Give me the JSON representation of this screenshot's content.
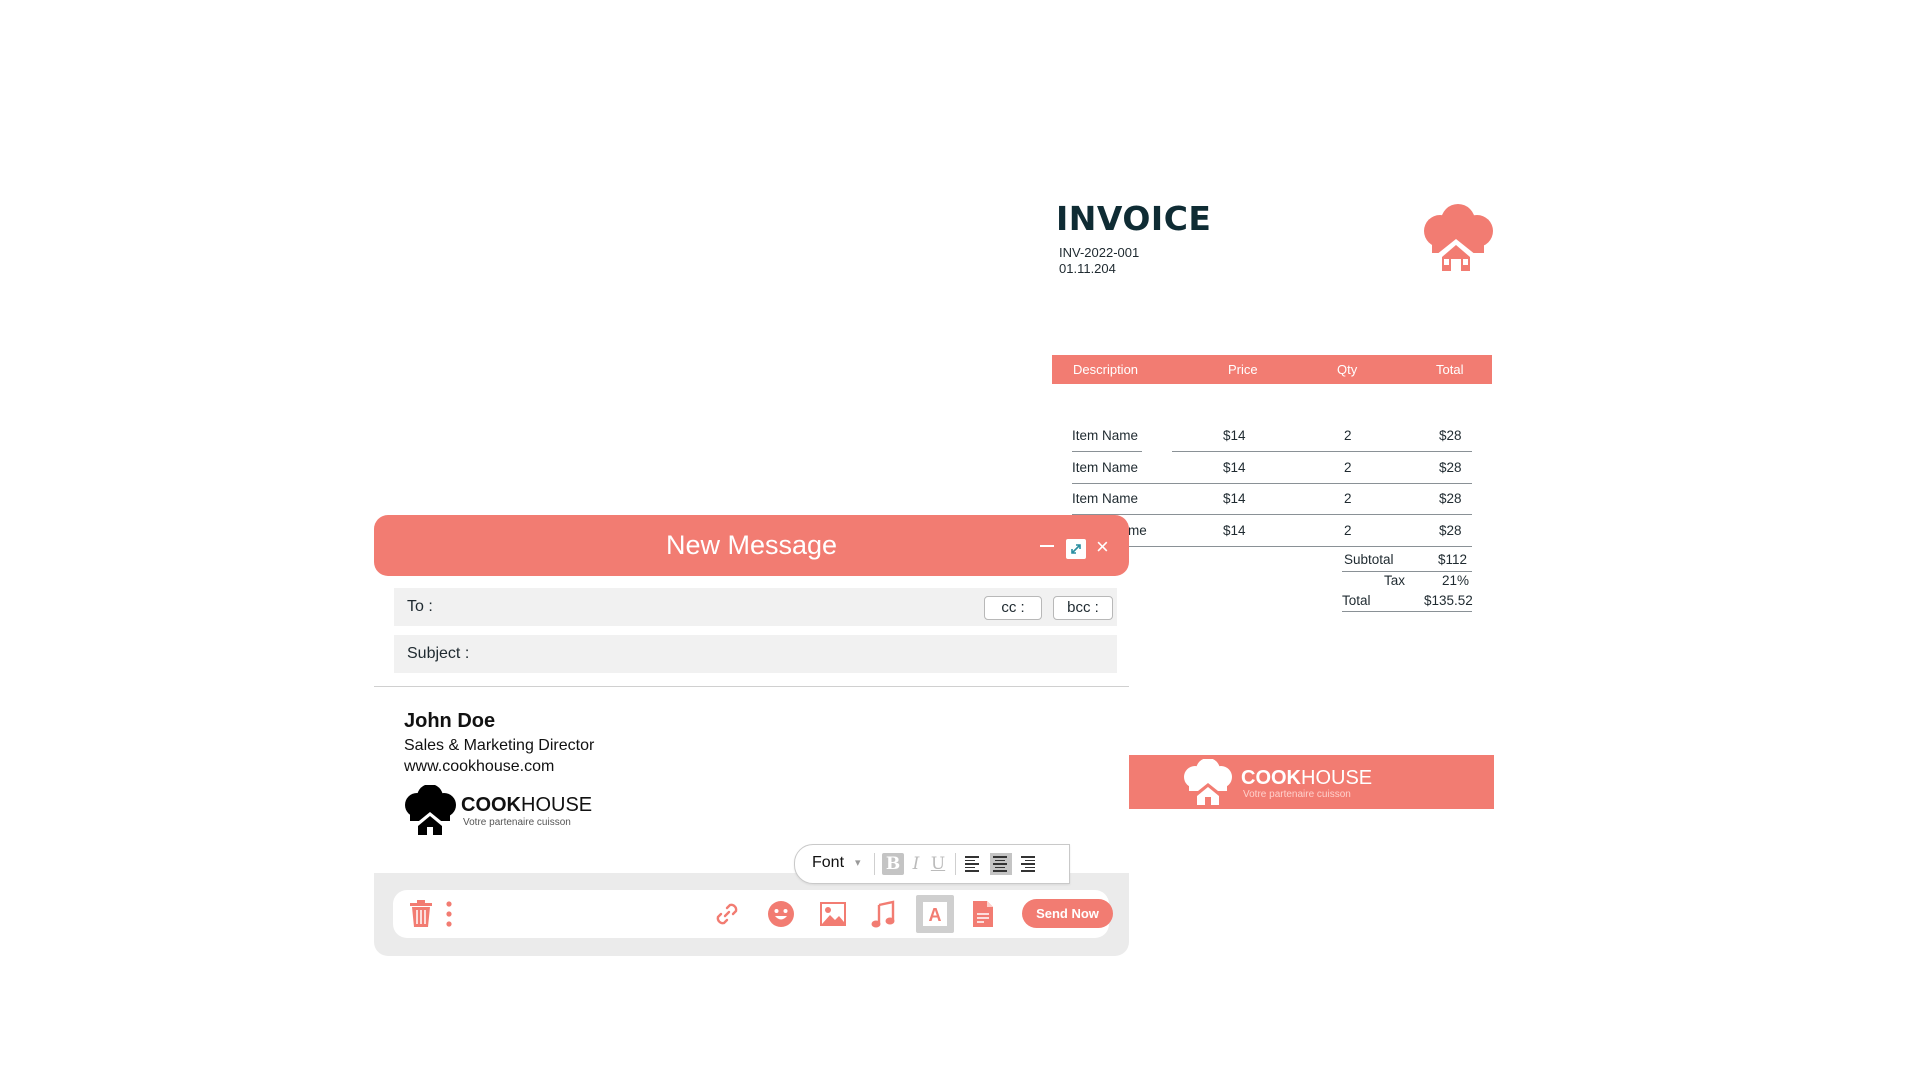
{
  "invoice": {
    "title": "INVOICE",
    "number": "INV-2022-001",
    "date": "01.11.204",
    "columns": [
      "Description",
      "Price",
      "Qty",
      "Total"
    ],
    "rows": [
      {
        "description": "Item Name",
        "price": "$14",
        "qty": "2",
        "total": "$28"
      },
      {
        "description": "Item Name",
        "price": "$14",
        "qty": "2",
        "total": "$28"
      },
      {
        "description": "Item Name",
        "price": "$14",
        "qty": "2",
        "total": "$28"
      },
      {
        "description": "me",
        "price": "$14",
        "qty": "2",
        "total": "$28"
      }
    ],
    "subtotal_label": "Subtotal",
    "subtotal_value": "$112",
    "tax_label": "Tax",
    "tax_value": "21%",
    "total_label": "Total",
    "total_value": "$135.52"
  },
  "banner": {
    "brand_bold": "COOK",
    "brand_light": "HOUSE",
    "tagline": "Votre partenaire cuisson"
  },
  "composer": {
    "title": "New Message",
    "close_symbol": "×",
    "to_label": "To :",
    "cc_label": "cc :",
    "bcc_label": "bcc :",
    "subject_label": "Subject  :",
    "signature": {
      "name": "John Doe",
      "role": "Sales & Marketing Director",
      "website": "www.cookhouse.com",
      "brand_bold": "COOK",
      "brand_light": "HOUSE",
      "tagline": "Votre partenaire cuisson"
    },
    "format_toolbar": {
      "font_label": "Font",
      "caret": "▾",
      "bold": "B",
      "italic": "I",
      "underline": "U"
    },
    "actions": {
      "icons": [
        "trash-icon",
        "more-icon",
        "link-icon",
        "emoji-icon",
        "image-icon",
        "music-icon",
        "text-icon",
        "document-icon"
      ],
      "text_icon_letter": "A",
      "send_label": "Send Now"
    }
  },
  "colors": {
    "accent": "#f27c72",
    "dark_title": "#0f2c34",
    "field_bg": "#f1f1f1"
  }
}
